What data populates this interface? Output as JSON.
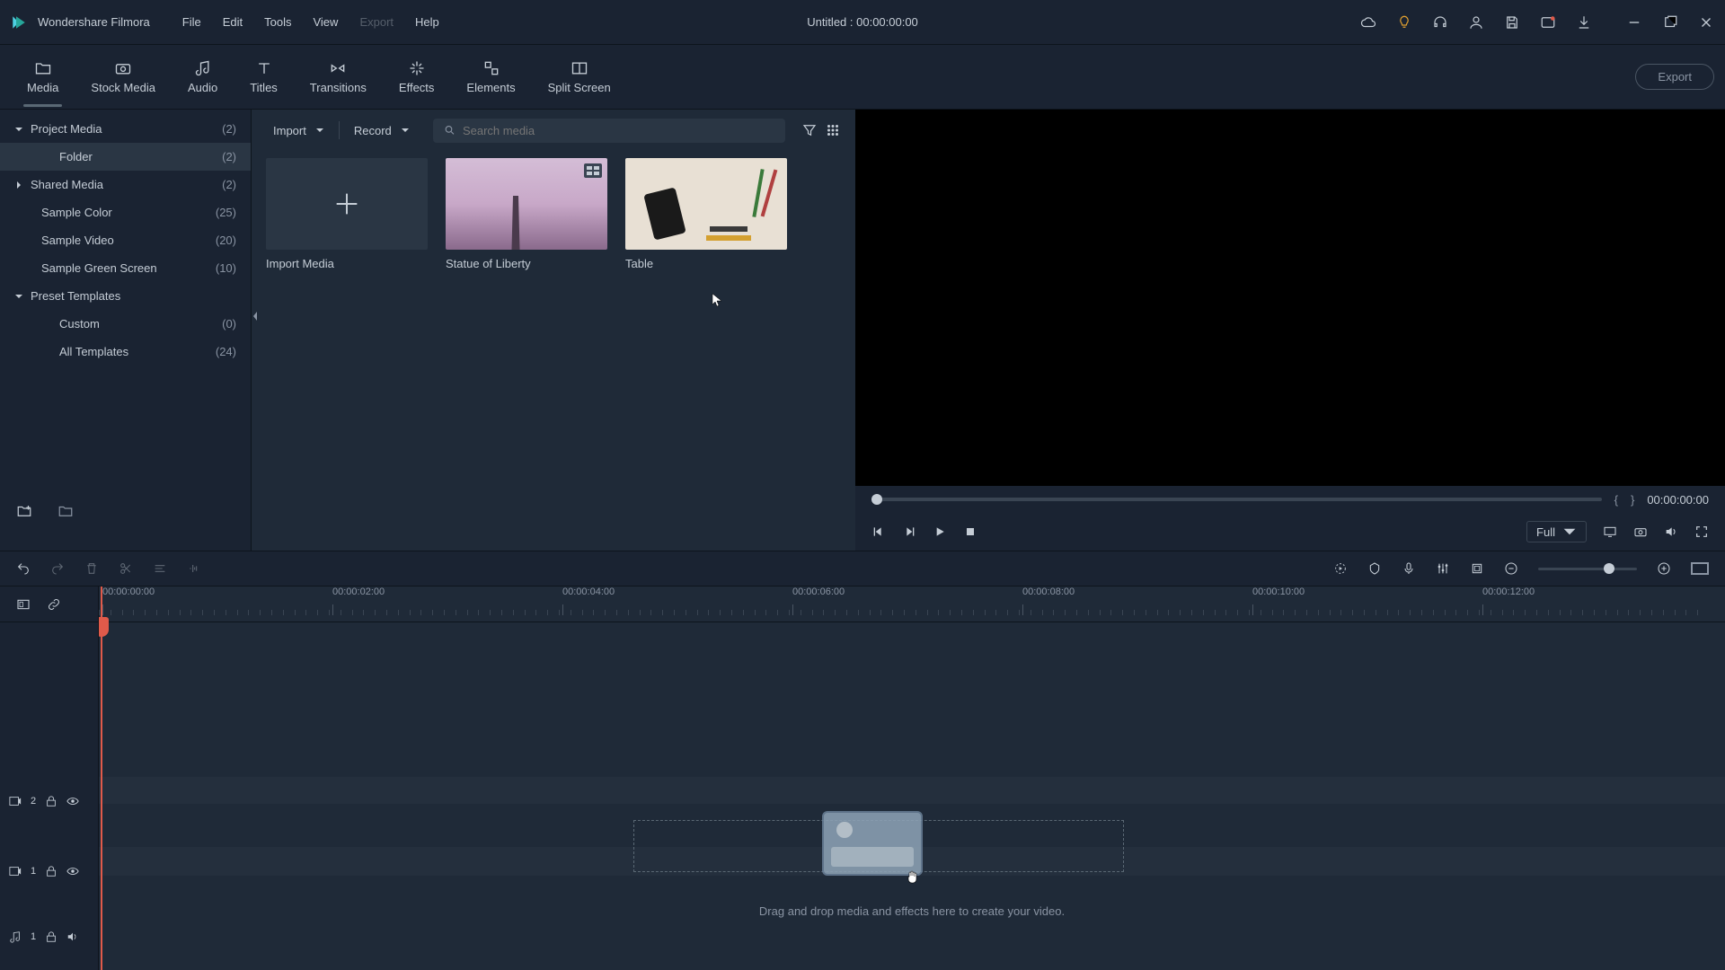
{
  "app": {
    "name": "Wondershare Filmora",
    "document_title": "Untitled : 00:00:00:00"
  },
  "menu": {
    "file": "File",
    "edit": "Edit",
    "tools": "Tools",
    "view": "View",
    "export": "Export",
    "help": "Help"
  },
  "tabs": {
    "media": "Media",
    "stock": "Stock Media",
    "audio": "Audio",
    "titles": "Titles",
    "transitions": "Transitions",
    "effects": "Effects",
    "elements": "Elements",
    "split": "Split Screen",
    "export_btn": "Export"
  },
  "sidebar": {
    "project_media": {
      "label": "Project Media",
      "count": "(2)"
    },
    "folder": {
      "label": "Folder",
      "count": "(2)"
    },
    "shared_media": {
      "label": "Shared Media",
      "count": "(2)"
    },
    "sample_color": {
      "label": "Sample Color",
      "count": "(25)"
    },
    "sample_video": {
      "label": "Sample Video",
      "count": "(20)"
    },
    "sample_green": {
      "label": "Sample Green Screen",
      "count": "(10)"
    },
    "preset_templates": {
      "label": "Preset Templates"
    },
    "custom": {
      "label": "Custom",
      "count": "(0)"
    },
    "all_templates": {
      "label": "All Templates",
      "count": "(24)"
    }
  },
  "media_toolbar": {
    "import": "Import",
    "record": "Record",
    "search_placeholder": "Search media"
  },
  "media_items": {
    "import_media": "Import Media",
    "liberty": "Statue of Liberty",
    "table": "Table"
  },
  "preview": {
    "timecode": "00:00:00:00",
    "quality": "Full",
    "brace_open": "{",
    "brace_close": "}"
  },
  "timeline": {
    "playhead_tc": "00:00:00:00",
    "ticks": [
      "00:00:02:00",
      "00:00:04:00",
      "00:00:06:00",
      "00:00:08:00",
      "00:00:10:00",
      "00:00:12:00"
    ],
    "tracks": {
      "v2": "2",
      "v1": "1",
      "a1": "1"
    },
    "drop_hint": "Drag and drop media and effects here to create your video."
  }
}
